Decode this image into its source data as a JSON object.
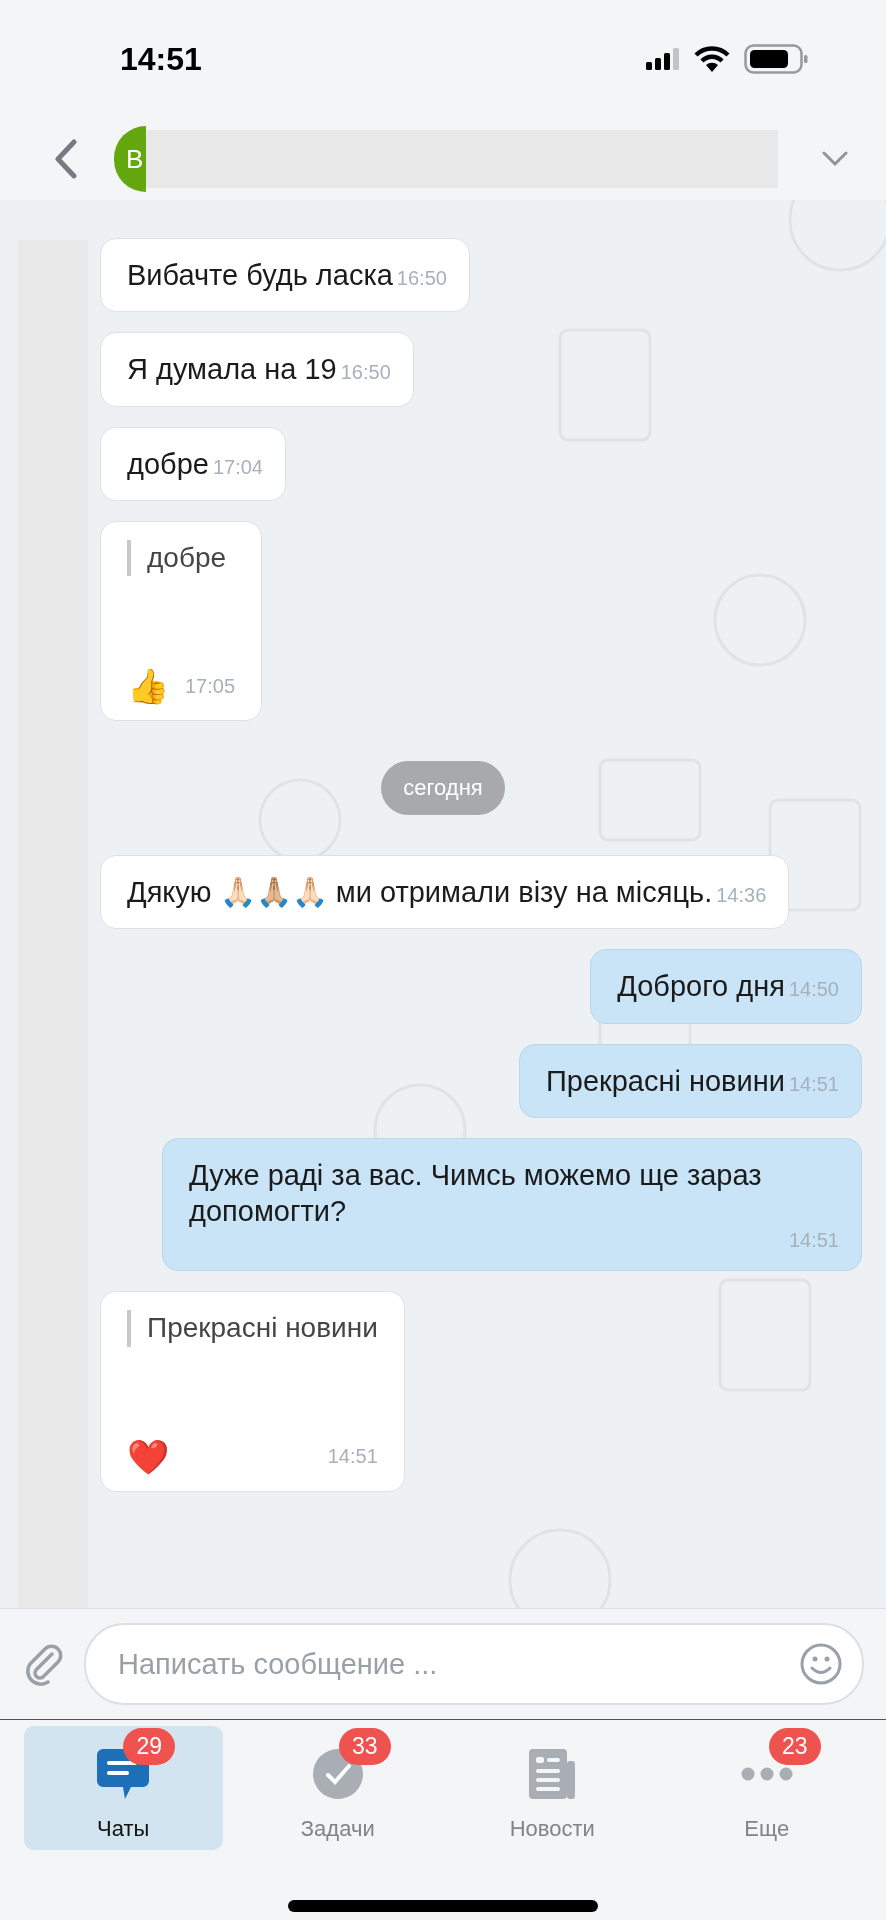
{
  "status_bar": {
    "time": "14:51"
  },
  "header": {
    "avatar_letter": "В"
  },
  "messages": [
    {
      "kind": "incoming",
      "text": "Вибачте будь ласка",
      "time": "16:50"
    },
    {
      "kind": "incoming",
      "text": "Я думала на 19",
      "time": "16:50"
    },
    {
      "kind": "incoming",
      "text": "добре",
      "time": "17:04"
    },
    {
      "kind": "reaction",
      "quote": "добре",
      "emoji": "👍",
      "time": "17:05"
    },
    {
      "kind": "date",
      "text": "сегодня"
    },
    {
      "kind": "incoming",
      "text": "Дякую 🙏🏻🙏🏼🙏🏻 ми отримали візу на місяць.",
      "time": "14:36"
    },
    {
      "kind": "outgoing",
      "text": "Доброго дня",
      "time": "14:50"
    },
    {
      "kind": "outgoing",
      "text": "Прекрасні новини",
      "time": "14:51"
    },
    {
      "kind": "outgoing",
      "text": "Дуже раді за вас. Чимсь можемо ще зараз допомогти?",
      "time": "14:51"
    },
    {
      "kind": "reaction",
      "quote": "Прекрасні новини",
      "emoji": "❤️",
      "time": "14:51"
    }
  ],
  "composer": {
    "placeholder": "Написать сообщение ..."
  },
  "tabs": [
    {
      "label": "Чаты",
      "badge": "29",
      "selected": true
    },
    {
      "label": "Задачи",
      "badge": "33",
      "selected": false
    },
    {
      "label": "Новости",
      "selected": false
    },
    {
      "label": "Еще",
      "badge": "23",
      "selected": false
    }
  ]
}
